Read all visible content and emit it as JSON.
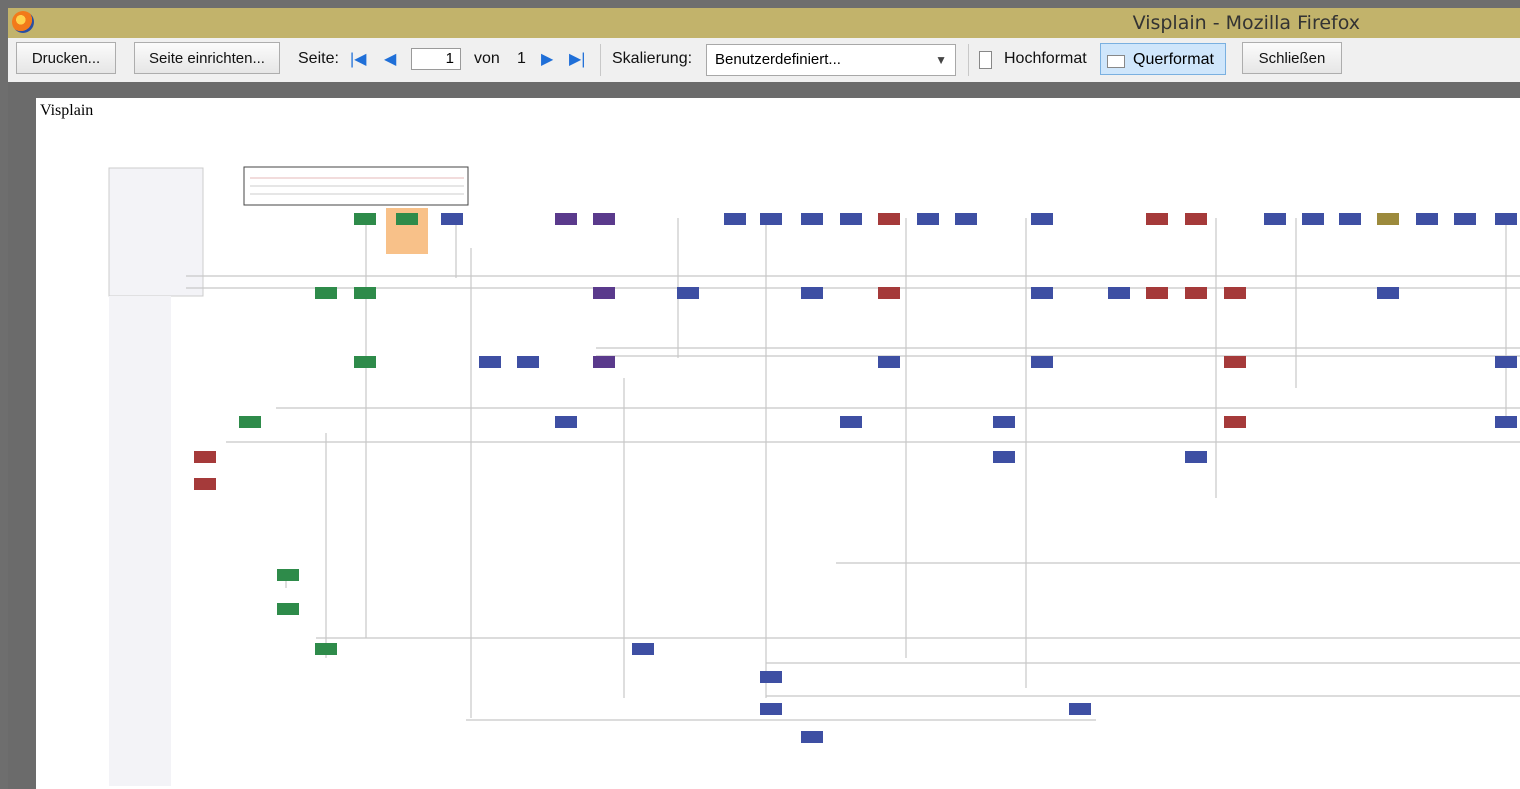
{
  "window": {
    "title": "Visplain - Mozilla Firefox"
  },
  "toolbar": {
    "print": "Drucken...",
    "page_setup": "Seite einrichten...",
    "page_label": "Seite:",
    "page_current": "1",
    "page_of": "von",
    "page_total": "1",
    "scale_label": "Skalierung:",
    "scale_value": "Benutzerdefiniert...",
    "portrait": "Hochformat",
    "landscape": "Querformat",
    "close": "Schließen"
  },
  "document": {
    "title": "Visplain"
  },
  "colors": {
    "green": "#2e8b4a",
    "blue": "#3e4fa3",
    "purple": "#5a3a8c",
    "red": "#a53a3a",
    "gold": "#9c8a3c",
    "highlight": "#f6b26b"
  }
}
